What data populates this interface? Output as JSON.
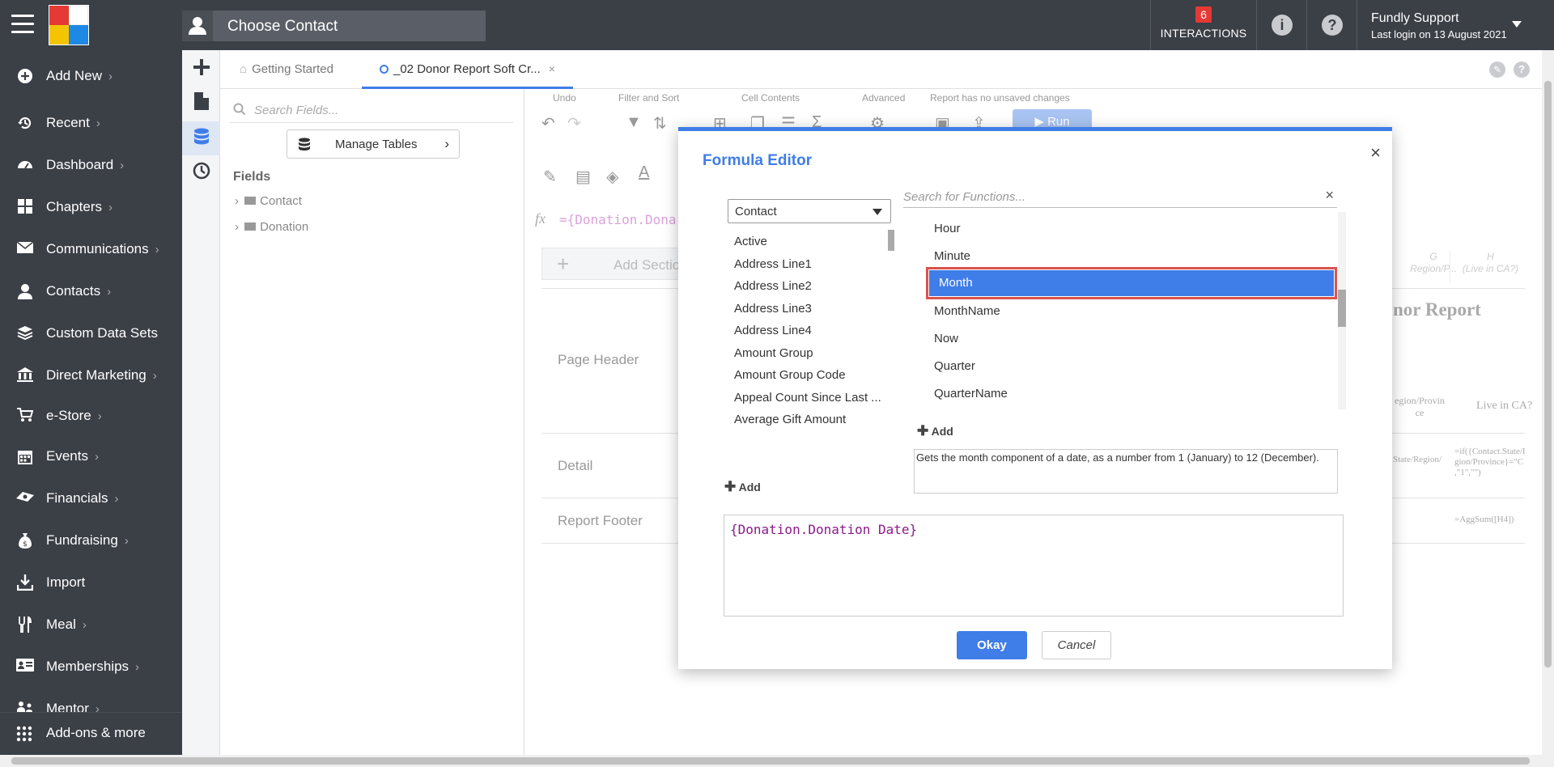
{
  "topbar": {
    "contact_placeholder": "Choose Contact",
    "interactions_count": "6",
    "interactions_label": "INTERACTIONS",
    "user_name": "Fundly Support",
    "last_login": "Last login on 13 August 2021",
    "logo_colors": [
      "#e53935",
      "#f5c400",
      "#1e88e5",
      "#ffffff"
    ]
  },
  "sidebar": {
    "items": [
      {
        "label": "Add New",
        "icon": "plus-circle-icon",
        "chevron": "›"
      },
      {
        "label": "Recent",
        "icon": "history-icon",
        "chevron": "›"
      },
      {
        "label": "Dashboard",
        "icon": "dashboard-icon",
        "chevron": "›"
      },
      {
        "label": "Chapters",
        "icon": "grid-icon",
        "chevron": "›"
      },
      {
        "label": "Communications",
        "icon": "envelope-icon",
        "chevron": "›"
      },
      {
        "label": "Contacts",
        "icon": "person-icon",
        "chevron": "›"
      },
      {
        "label": "Custom Data Sets",
        "icon": "layers-icon",
        "chevron": ""
      },
      {
        "label": "Direct Marketing",
        "icon": "bank-icon",
        "chevron": "›"
      },
      {
        "label": "e-Store",
        "icon": "cart-icon",
        "chevron": "›"
      },
      {
        "label": "Events",
        "icon": "calendar-icon",
        "chevron": "›"
      },
      {
        "label": "Financials",
        "icon": "money-icon",
        "chevron": "›"
      },
      {
        "label": "Fundraising",
        "icon": "moneybag-icon",
        "chevron": "›"
      },
      {
        "label": "Import",
        "icon": "import-icon",
        "chevron": ""
      },
      {
        "label": "Meal",
        "icon": "utensils-icon",
        "chevron": "›"
      },
      {
        "label": "Memberships",
        "icon": "id-card-icon",
        "chevron": "›"
      },
      {
        "label": "Mentor",
        "icon": "mentor-icon",
        "chevron": "›"
      }
    ],
    "bottom_label": "Add-ons & more"
  },
  "tabs": {
    "getting_started": "Getting Started",
    "report": "_02 Donor Report Soft Cr...",
    "close": "×"
  },
  "fields_panel": {
    "search_placeholder": "Search Fields...",
    "manage_tables": "Manage Tables",
    "fields_title": "Fields",
    "tree": [
      "Contact",
      "Donation"
    ]
  },
  "designer": {
    "toolbar_labels": [
      "Undo",
      "Filter and Sort",
      "Cell Contents",
      "Advanced",
      "Report has no unsaved changes"
    ],
    "run_label": "Run",
    "formula_prefix": "={Donation.Dona",
    "add_section": "Add Sectio",
    "sections": [
      "Page Header",
      "Detail",
      "Report Footer"
    ],
    "col_g": "G",
    "col_g_sub": "Region/P...",
    "col_h": "H",
    "col_h_sub": "(Live in CA?)",
    "report_title_fragment": "nor Report",
    "hdr_region": "egion/Provin",
    "hdr_region2": "ce",
    "hdr_live": "Live in CA?",
    "cell_region": "State/Region/",
    "cell_live1": "=if({Contact.State/I",
    "cell_live2": "gion/Province}=\"C",
    "cell_live3": ",\"1\",\"\")",
    "cell_footer": "=AggSum([H4])"
  },
  "modal": {
    "title": "Formula Editor",
    "close": "×",
    "table_select": "Contact",
    "fields": [
      "Active",
      "Address Line1",
      "Address Line2",
      "Address Line3",
      "Address Line4",
      "Amount Group",
      "Amount Group Code",
      "Appeal Count Since Last ...",
      "Average Gift Amount"
    ],
    "add_label": "Add",
    "func_search_placeholder": "Search for Functions...",
    "functions": [
      "Hour",
      "Minute",
      "Month",
      "MonthName",
      "Now",
      "Quarter",
      "QuarterName"
    ],
    "selected_function": "Month",
    "description": "Gets the month component of a date, as a number from 1 (January) to 12 (December).",
    "formula": "{Donation.Donation Date}",
    "okay": "Okay",
    "cancel": "Cancel",
    "accent_color": "#3f7de8",
    "highlight_color": "#d9534f"
  }
}
